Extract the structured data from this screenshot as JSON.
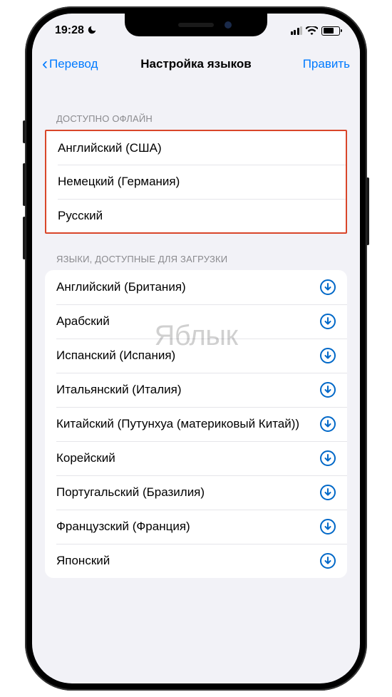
{
  "status": {
    "time": "19:28",
    "dnd_icon": "moon-icon"
  },
  "nav": {
    "back_label": "Перевод",
    "title": "Настройка языков",
    "edit_label": "Править"
  },
  "sections": {
    "offline": {
      "header": "ДОСТУПНО ОФЛАЙН",
      "items": [
        {
          "label": "Английский (США)"
        },
        {
          "label": "Немецкий (Германия)"
        },
        {
          "label": "Русский"
        }
      ]
    },
    "downloadable": {
      "header": "ЯЗЫКИ, ДОСТУПНЫЕ ДЛЯ ЗАГРУЗКИ",
      "items": [
        {
          "label": "Английский (Британия)"
        },
        {
          "label": "Арабский"
        },
        {
          "label": "Испанский (Испания)"
        },
        {
          "label": "Итальянский (Италия)"
        },
        {
          "label": "Китайский (Путунхуа (материковый Китай))"
        },
        {
          "label": "Корейский"
        },
        {
          "label": "Португальский (Бразилия)"
        },
        {
          "label": "Французский (Франция)"
        },
        {
          "label": "Японский"
        }
      ]
    }
  },
  "watermark": "Яблык",
  "colors": {
    "accent": "#007aff",
    "download_icon": "#0068c8",
    "highlight_border": "#d9462a",
    "bg": "#f2f2f7"
  }
}
